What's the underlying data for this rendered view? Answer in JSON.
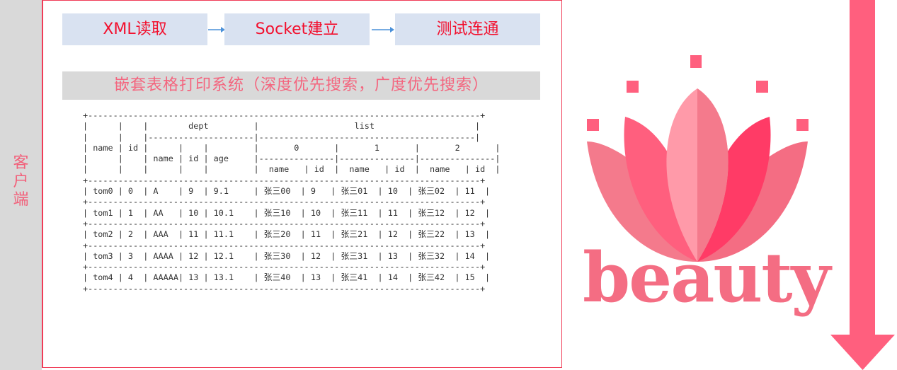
{
  "sidebar": {
    "label_chars": [
      "客",
      "户",
      "端"
    ]
  },
  "steps": [
    {
      "label": "XML读取"
    },
    {
      "label": "Socket建立"
    },
    {
      "label": "测试连通"
    }
  ],
  "banner": {
    "title": "嵌套表格打印系统（深度优先搜索，广度优先搜索）"
  },
  "ascii_table": {
    "lines": [
      "+------------------------------------------------------------------------------+",
      "|      |    |        dept         |                   list                    |",
      "|      |    |---------------------|-------------------------------------------|",
      "| name | id |      |    |         |       0       |       1       |       2       |",
      "|      |    | name | id | age     |---------------|---------------|---------------|",
      "|      |    |      |    |         |  name   | id  |  name   | id  |  name   | id  |",
      "+------------------------------------------------------------------------------+",
      "| tom0 | 0  | A    | 9  | 9.1     | 张三00  | 9   | 张三01  | 10  | 张三02  | 11  |",
      "+------------------------------------------------------------------------------+",
      "| tom1 | 1  | AA   | 10 | 10.1    | 张三10  | 10  | 张三11  | 11  | 张三12  | 12  |",
      "+------------------------------------------------------------------------------+",
      "| tom2 | 2  | AAA  | 11 | 11.1    | 张三20  | 11  | 张三21  | 12  | 张三22  | 13  |",
      "+------------------------------------------------------------------------------+",
      "| tom3 | 3  | AAAA | 12 | 12.1    | 张三30  | 12  | 张三31  | 13  | 张三32  | 14  |",
      "+------------------------------------------------------------------------------+",
      "| tom4 | 4  | AAAAA| 13 | 13.1    | 张三40  | 13  | 张三41  | 14  | 张三42  | 15  |",
      "+------------------------------------------------------------------------------+"
    ]
  },
  "logo": {
    "word": "beauty",
    "icon": "lotus-icon"
  },
  "colors": {
    "accent_red": "#f2102e",
    "pink_text": "#f4657e",
    "frame_border": "#f03c57",
    "step_fill": "#d9e2f1",
    "banner_fill": "#d9d9d9",
    "big_arrow": "#ff5f7e"
  }
}
